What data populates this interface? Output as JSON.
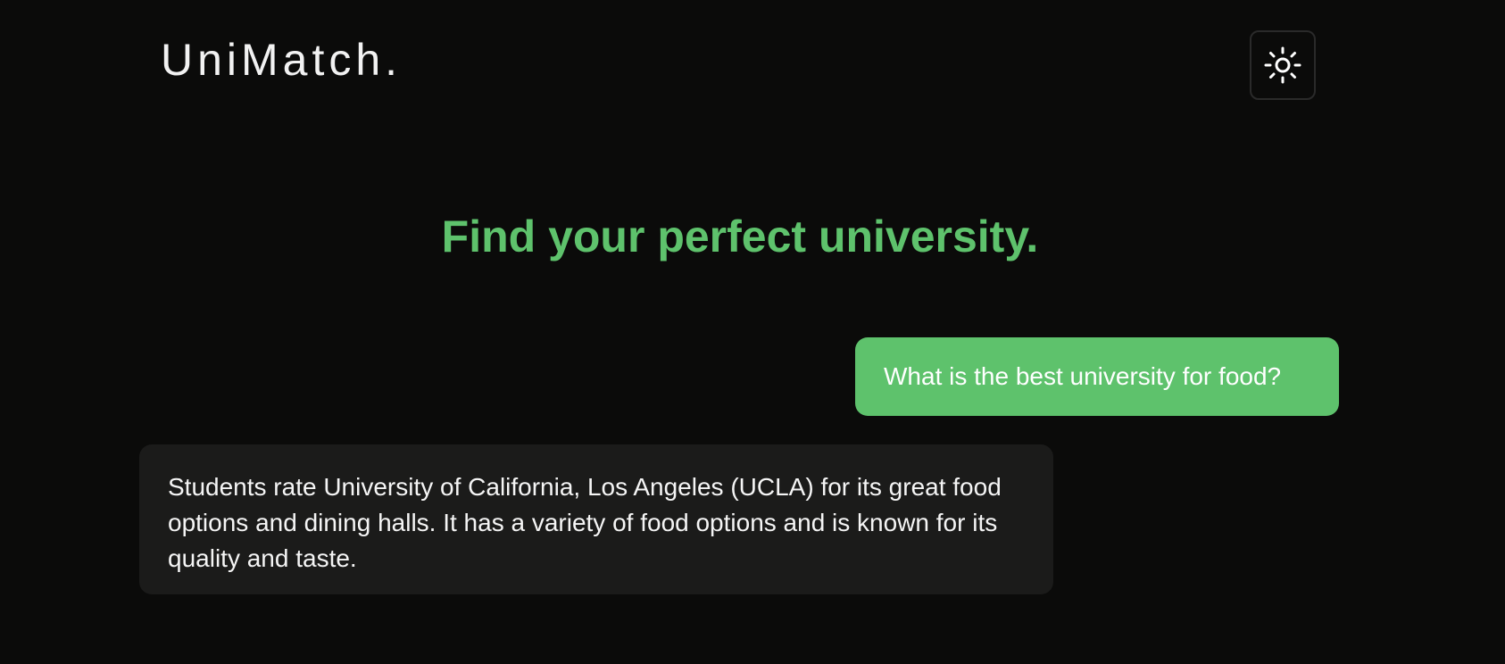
{
  "header": {
    "logo": "UniMatch.",
    "theme_toggle_icon": "sun-icon"
  },
  "main": {
    "headline": "Find your perfect university."
  },
  "chat": {
    "messages": [
      {
        "role": "user",
        "text": "What is the best university for food?"
      },
      {
        "role": "assistant",
        "text": "Students rate University of California, Los Angeles (UCLA) for its great food options and dining halls. It has a variety of food options and is known for its quality and taste."
      }
    ]
  },
  "colors": {
    "background": "#0b0b0a",
    "accent": "#5ec26c",
    "assistant_bubble": "#1b1b1a"
  }
}
